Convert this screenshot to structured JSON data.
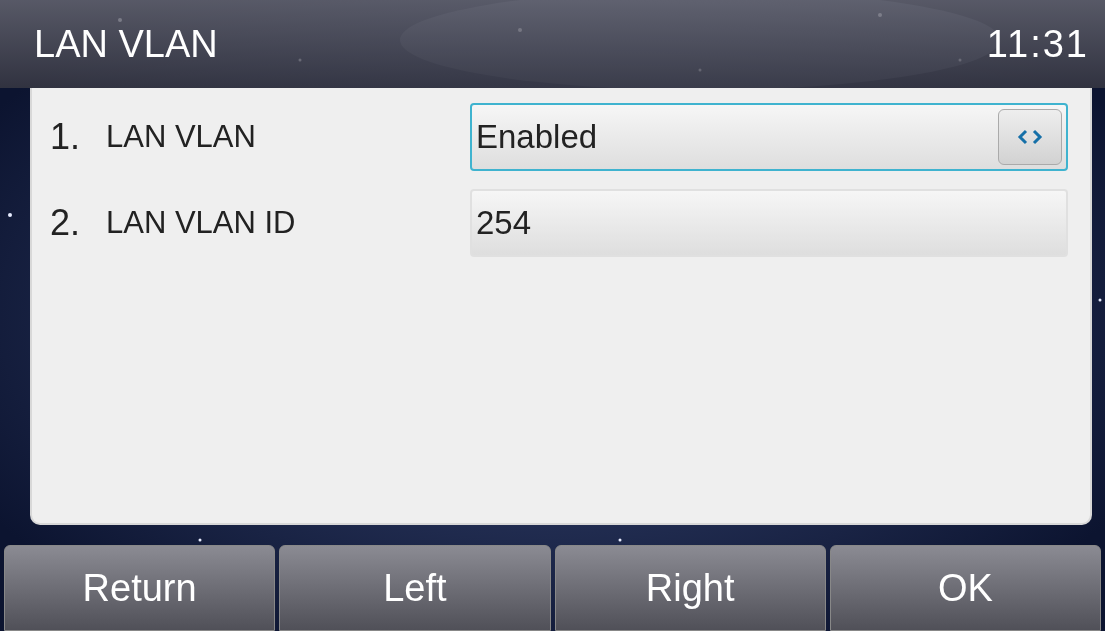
{
  "title_bar": {
    "title": "LAN VLAN",
    "time": "11:31"
  },
  "settings": [
    {
      "index": "1.",
      "label": "LAN VLAN",
      "kind": "select",
      "value": "Enabled",
      "selected": true
    },
    {
      "index": "2.",
      "label": "LAN VLAN ID",
      "kind": "input",
      "value": "254",
      "selected": false
    }
  ],
  "softkeys": [
    "Return",
    "Left",
    "Right",
    "OK"
  ]
}
